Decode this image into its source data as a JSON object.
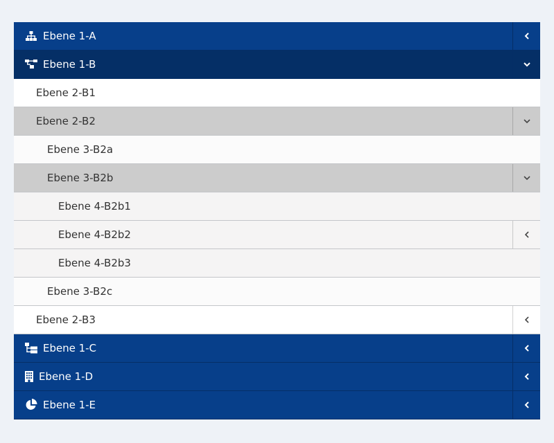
{
  "menu": {
    "l1a": {
      "label": "Ebene 1-A",
      "icon": "sitemap-icon"
    },
    "l1b": {
      "label": "Ebene 1-B",
      "icon": "tree-diagram-icon"
    },
    "l2b1": {
      "label": "Ebene 2-B1"
    },
    "l2b2": {
      "label": "Ebene 2-B2"
    },
    "l3b2a": {
      "label": "Ebene 3-B2a"
    },
    "l3b2b": {
      "label": "Ebene 3-B2b"
    },
    "l4b2b1": {
      "label": "Ebene 4-B2b1"
    },
    "l4b2b2": {
      "label": "Ebene 4-B2b2"
    },
    "l4b2b3": {
      "label": "Ebene 4-B2b3"
    },
    "l3b2c": {
      "label": "Ebene 3-B2c"
    },
    "l2b3": {
      "label": "Ebene 2-B3"
    },
    "l1c": {
      "label": "Ebene 1-C",
      "icon": "hierarchy-icon"
    },
    "l1d": {
      "label": "Ebene 1-D",
      "icon": "building-icon"
    },
    "l1e": {
      "label": "Ebene 1-E",
      "icon": "pie-chart-icon"
    }
  },
  "colors": {
    "level1": "#073f8a",
    "level1_open": "#052f66",
    "active": "#cccccc",
    "page_bg": "#eef2f7"
  }
}
